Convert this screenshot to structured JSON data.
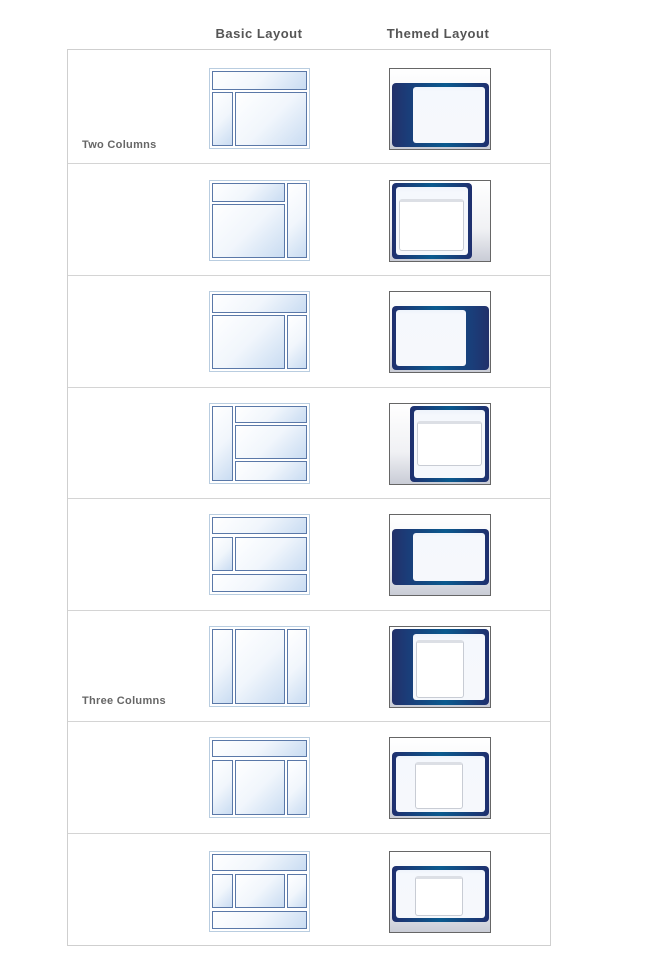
{
  "headers": {
    "basic": "Basic Layout",
    "themed": "Themed Layout"
  },
  "rows": [
    {
      "label": "Two Columns",
      "basic": "header + left sidebar + main",
      "themed": "left dark sidebar"
    },
    {
      "label": "",
      "basic": "header + main + right sidebar",
      "themed": "framed main with right gray"
    },
    {
      "label": "",
      "basic": "header + main + right sidebar (top)",
      "themed": "right dark sidebar"
    },
    {
      "label": "",
      "basic": "left sidebar + header + main + footer",
      "themed": "framed main with left gray"
    },
    {
      "label": "",
      "basic": "header + left sidebar + main + footer",
      "themed": "left dark sidebar with footer"
    },
    {
      "label": "Three Columns",
      "basic": "left + center + right columns",
      "themed": "three column framed"
    },
    {
      "label": "",
      "basic": "header + three columns",
      "themed": "framed three column"
    },
    {
      "label": "",
      "basic": "header + three columns + footer",
      "themed": "framed three column with footer"
    }
  ],
  "colors": {
    "theme_dark": "#1f2f6e",
    "theme_accent": "#0a5a8e",
    "cell_border": "#5a78a8",
    "thumb_border": "#b9cde0",
    "grid_line": "#d4d4d4",
    "label_text": "#666666"
  }
}
